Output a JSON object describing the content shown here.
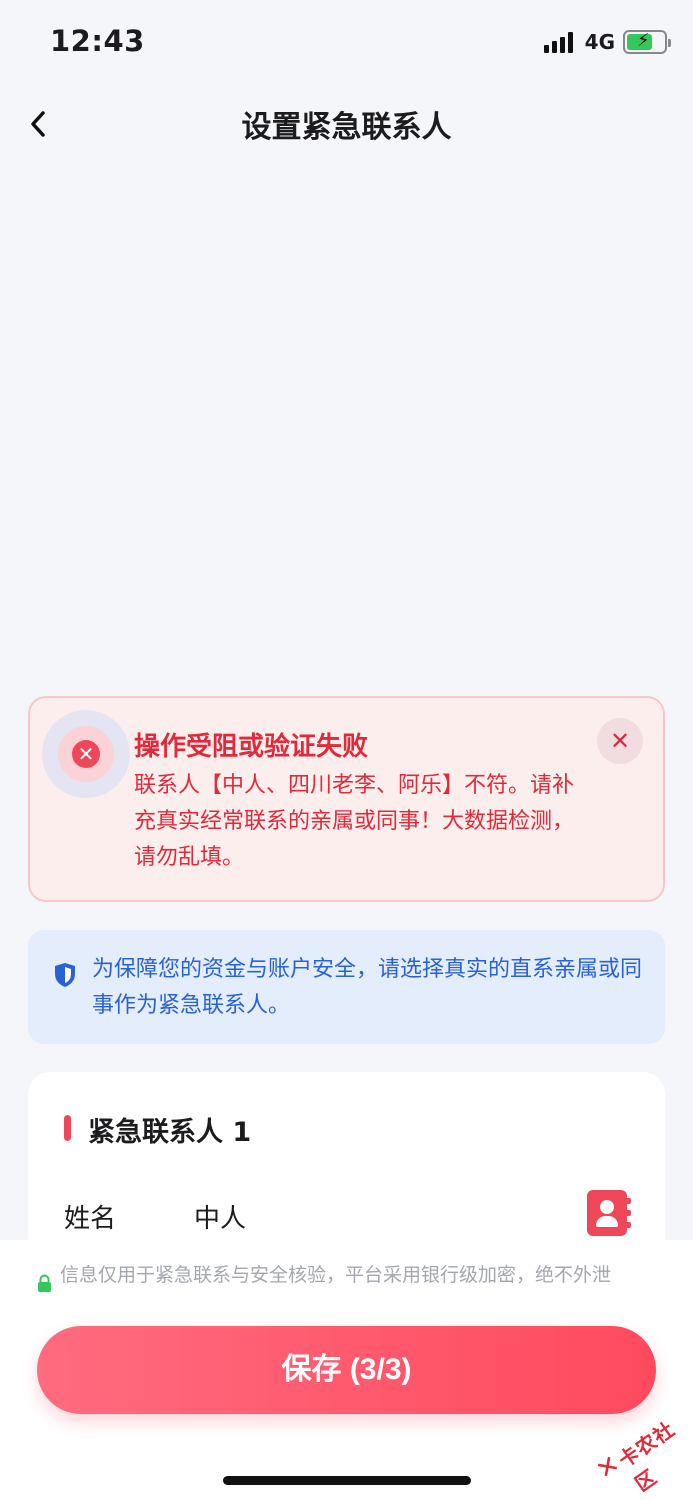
{
  "status_bar": {
    "time": "12:43",
    "network": "4G",
    "battery_level": 0.7
  },
  "nav": {
    "title": "设置紧急联系人"
  },
  "alert": {
    "title": "操作受阻或验证失败",
    "message": "联系人【中人、四川老李、阿乐】不符。请补充真实经常联系的亲属或同事！大数据检测，请勿乱填。"
  },
  "info": {
    "text": "为保障您的资金与账户安全，请选择真实的直系亲属或同事作为紧急联系人。"
  },
  "contact_card": {
    "title": "紧急联系人 1",
    "name_label": "姓名",
    "name_value": "中人"
  },
  "footer": {
    "privacy_note": "信息仅用于紧急联系与安全核验，平台采用银行级加密，绝不外泄",
    "save_label": "保存 (3/3)"
  },
  "watermark": {
    "text": "卡农社区"
  },
  "colors": {
    "accent_red": "#f0465a",
    "alert_text": "#e02a3a",
    "info_blue": "#2a62d6",
    "info_bg": "#e3edfb"
  }
}
